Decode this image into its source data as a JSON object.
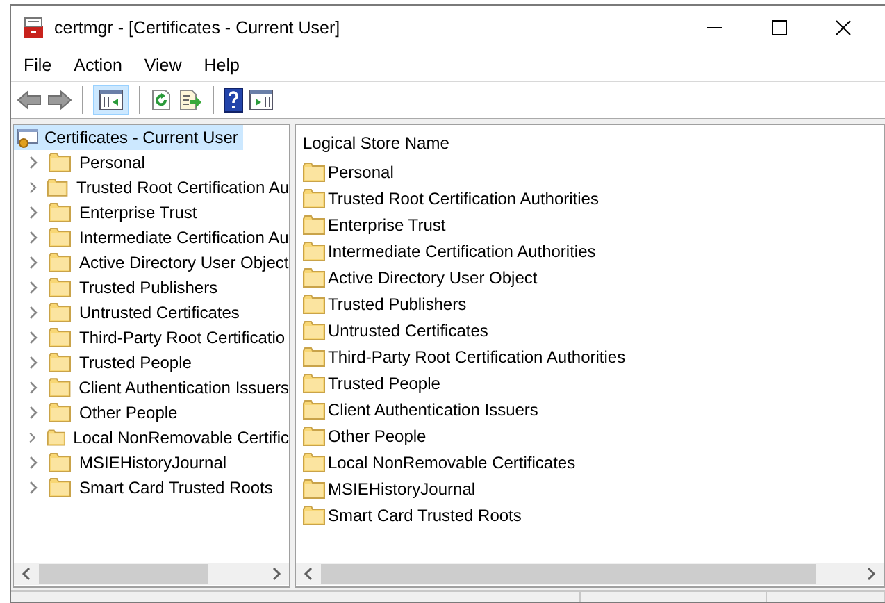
{
  "window": {
    "title": "certmgr - [Certificates - Current User]"
  },
  "menu": [
    "File",
    "Action",
    "View",
    "Help"
  ],
  "toolbar": [
    {
      "kind": "back",
      "disabled": true
    },
    {
      "kind": "forward",
      "disabled": true
    },
    {
      "kind": "separator"
    },
    {
      "kind": "tree-toggle",
      "pressed": true
    },
    {
      "kind": "separator"
    },
    {
      "kind": "refresh"
    },
    {
      "kind": "export"
    },
    {
      "kind": "separator"
    },
    {
      "kind": "help"
    },
    {
      "kind": "action-pane"
    }
  ],
  "tree": {
    "label": "Certificates - Current User",
    "selected": true,
    "children": [
      {
        "label": "Personal",
        "selected": false,
        "expanded": false
      },
      {
        "label": "Trusted Root Certification Au",
        "selected": false,
        "expanded": false
      },
      {
        "label": "Enterprise Trust",
        "selected": false,
        "expanded": false
      },
      {
        "label": "Intermediate Certification Au",
        "selected": false,
        "expanded": false
      },
      {
        "label": "Active Directory User Object",
        "selected": false,
        "expanded": false
      },
      {
        "label": "Trusted Publishers",
        "selected": false,
        "expanded": false
      },
      {
        "label": "Untrusted Certificates",
        "selected": false,
        "expanded": false
      },
      {
        "label": "Third-Party Root Certificatio",
        "selected": false,
        "expanded": false
      },
      {
        "label": "Trusted People",
        "selected": false,
        "expanded": false
      },
      {
        "label": "Client Authentication Issuers",
        "selected": false,
        "expanded": false
      },
      {
        "label": "Other People",
        "selected": false,
        "expanded": false
      },
      {
        "label": "Local NonRemovable Certific",
        "selected": false,
        "expanded": false
      },
      {
        "label": "MSIEHistoryJournal",
        "selected": false,
        "expanded": false
      },
      {
        "label": "Smart Card Trusted Roots",
        "selected": false,
        "expanded": false
      }
    ]
  },
  "list": {
    "columns": [
      "Logical Store Name"
    ],
    "rows": [
      "Personal",
      "Trusted Root Certification Authorities",
      "Enterprise Trust",
      "Intermediate Certification Authorities",
      "Active Directory User Object",
      "Trusted Publishers",
      "Untrusted Certificates",
      "Third-Party Root Certification Authorities",
      "Trusted People",
      "Client Authentication Issuers",
      "Other People",
      "Local NonRemovable Certificates",
      "MSIEHistoryJournal",
      "Smart Card Trusted Roots"
    ]
  }
}
